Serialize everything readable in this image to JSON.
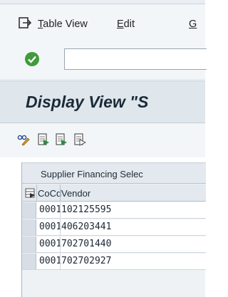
{
  "menubar": {
    "items": [
      {
        "label": "Table View",
        "mnemonic": "T",
        "rest": "able View"
      },
      {
        "label": "Edit",
        "mnemonic": "E",
        "rest": "dit"
      },
      {
        "label": "G",
        "mnemonic": "G",
        "rest": ""
      }
    ]
  },
  "header": {
    "title": "Display View \"S"
  },
  "table": {
    "title": "Supplier Financing Selec",
    "columns": [
      "CoCd",
      "Vendor"
    ],
    "rows": [
      {
        "cocd": "0001",
        "vendor": "102125595"
      },
      {
        "cocd": "0001",
        "vendor": "406203441"
      },
      {
        "cocd": "0001",
        "vendor": "702701440"
      },
      {
        "cocd": "0001",
        "vendor": "702702927"
      }
    ]
  },
  "icons": {
    "menu": "menu-exit-icon",
    "ok": "checkmark-circle-icon",
    "toolbar": [
      "glasses-pencil-icon",
      "new-entries-icon",
      "copy-entry-icon",
      "delete-entry-icon"
    ],
    "select_all": "select-all-icon"
  },
  "colors": {
    "ok_green": "#3f9b3b",
    "title_bg": "#dfe6ec",
    "toolbar_icon_green": "#2e8b3e"
  }
}
